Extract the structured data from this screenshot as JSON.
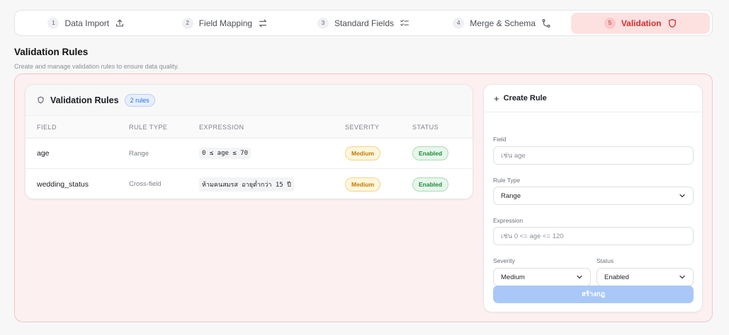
{
  "steps": [
    {
      "num": "1",
      "label": "Data Import",
      "icon": "upload-icon"
    },
    {
      "num": "2",
      "label": "Field Mapping",
      "icon": "swap-arrows-icon"
    },
    {
      "num": "3",
      "label": "Standard Fields",
      "icon": "checklist-icon"
    },
    {
      "num": "4",
      "label": "Merge & Schema",
      "icon": "merge-icon"
    },
    {
      "num": "5",
      "label": "Validation",
      "icon": "shield-icon",
      "active": true
    }
  ],
  "page": {
    "title": "Validation Rules",
    "subtitle": "Create and manage validation rules to ensure data quality."
  },
  "rules": {
    "title": "Validation Rules",
    "count": "2 rules",
    "columns": {
      "field": "FIELD",
      "rule_type": "RULE TYPE",
      "expression": "EXPRESSION",
      "severity": "SEVERITY",
      "status": "STATUS"
    },
    "rows": [
      {
        "field": "age",
        "rule_type": "Range",
        "expression": "0 ≤ age ≤ 70",
        "severity": "Medium",
        "status": "Enabled"
      },
      {
        "field": "wedding_status",
        "rule_type": "Cross-field",
        "expression": "ห้ามคนสมรส อายุต่ำกว่า 15 ปี",
        "severity": "Medium",
        "status": "Enabled"
      }
    ]
  },
  "create": {
    "title": "Create Rule",
    "field_label": "Field",
    "field_placeholder": "เช่น age",
    "rule_type_label": "Rule Type",
    "rule_type_value": "Range",
    "expression_label": "Expression",
    "expression_placeholder": "เช่น 0 <= age <= 120",
    "severity_label": "Severity",
    "severity_value": "Medium",
    "status_label": "Status",
    "status_value": "Enabled",
    "submit_label": "สร้างกฎ"
  },
  "colors": {
    "accent_red": "#d92d2d",
    "primary_blue_disabled": "#a9c8f7",
    "severity_amber": "#c27a00",
    "status_green": "#1d8a3a"
  }
}
